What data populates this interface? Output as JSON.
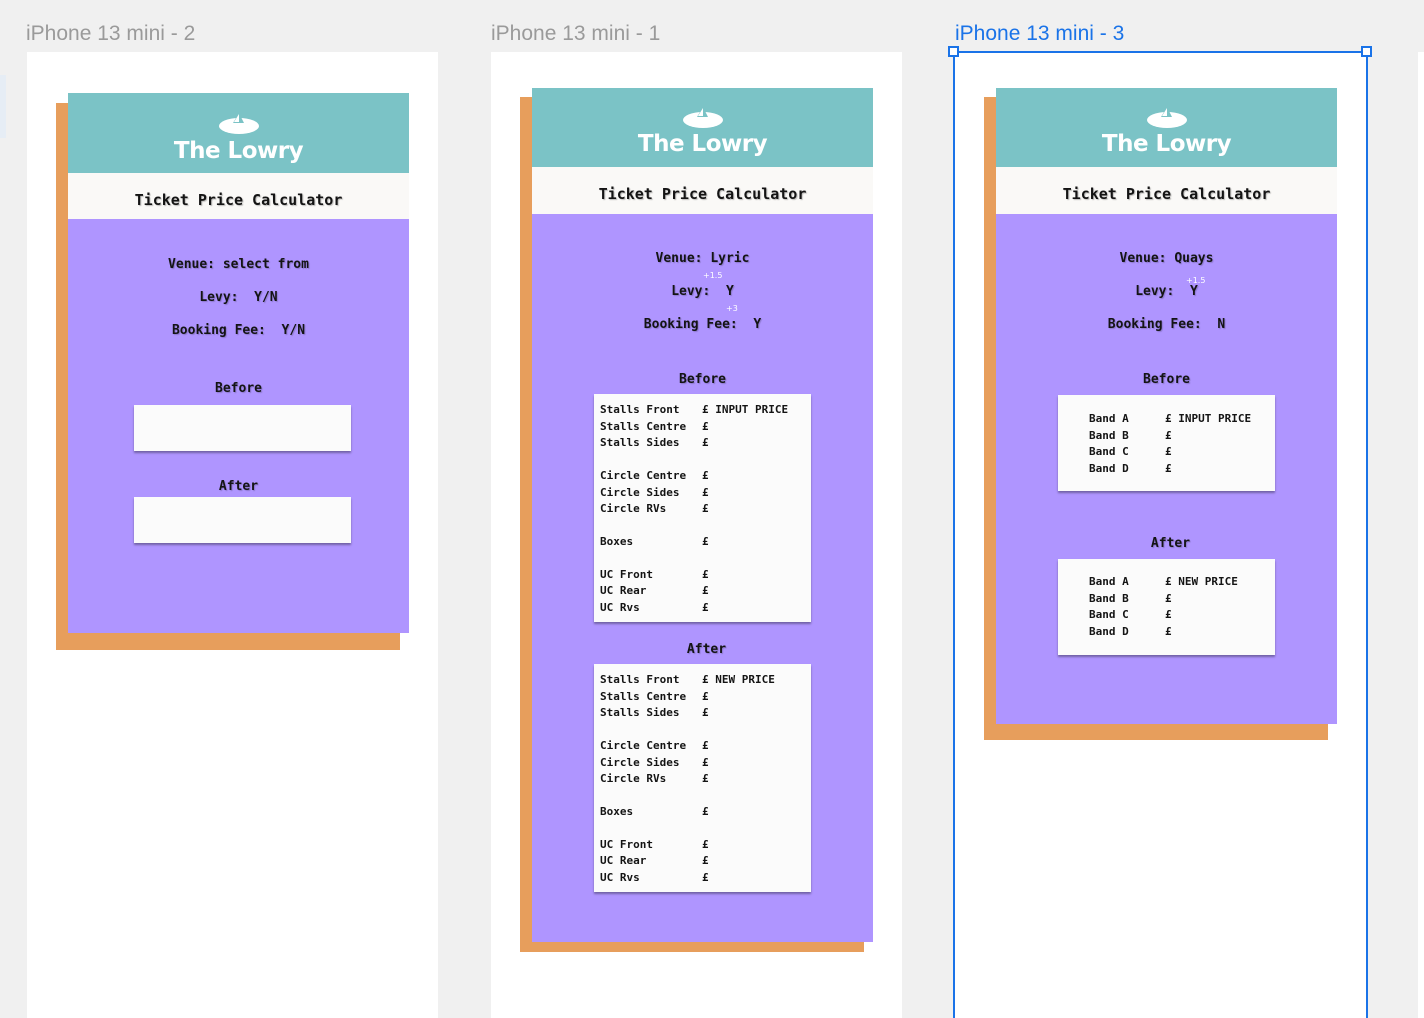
{
  "canvas": {
    "background": "#f0f0f0"
  },
  "colors": {
    "teal": "#7bc3c6",
    "purple": "#af95ff",
    "orange": "#e79e5c",
    "selection": "#1a73e8"
  },
  "frames": [
    {
      "label": "iPhone 13 mini - 2",
      "logo_text": "The Lowry",
      "title": "Ticket Price Calculator",
      "venue": "Venue: select from",
      "levy": "Levy:  Y/N",
      "booking_fee": "Booking Fee:  Y/N",
      "before_label": "Before",
      "after_label": "After"
    },
    {
      "label": "iPhone 13 mini - 1",
      "logo_text": "The Lowry",
      "title": "Ticket Price Calculator",
      "venue": "Venue: Lyric",
      "levy": "Levy:  Y",
      "levy_note": "+1.5",
      "booking_fee": "Booking Fee:  Y",
      "booking_note": "+3",
      "before_label": "Before",
      "after_label": "After",
      "before_rows": [
        [
          "Stalls Front",
          "£ INPUT PRICE"
        ],
        [
          "Stalls Centre",
          "£"
        ],
        [
          "Stalls Sides",
          "£"
        ],
        [
          "Circle Centre",
          "£"
        ],
        [
          "Circle Sides",
          "£"
        ],
        [
          "Circle RVs",
          "£"
        ],
        [
          "Boxes",
          "£"
        ],
        [
          "UC Front",
          "£"
        ],
        [
          "UC Rear",
          "£"
        ],
        [
          "UC Rvs",
          "£"
        ]
      ],
      "after_rows": [
        [
          "Stalls Front",
          "£ NEW PRICE"
        ],
        [
          "Stalls Centre",
          "£"
        ],
        [
          "Stalls Sides",
          "£"
        ],
        [
          "Circle Centre",
          "£"
        ],
        [
          "Circle Sides",
          "£"
        ],
        [
          "Circle RVs",
          "£"
        ],
        [
          "Boxes",
          "£"
        ],
        [
          "UC Front",
          "£"
        ],
        [
          "UC Rear",
          "£"
        ],
        [
          "UC Rvs",
          "£"
        ]
      ]
    },
    {
      "label": "iPhone 13 mini - 3",
      "logo_text": "The Lowry",
      "title": "Ticket Price Calculator",
      "venue": "Venue: Quays",
      "levy": "Levy:  Y",
      "levy_note": "+1.5",
      "booking_fee": "Booking Fee:  N",
      "before_label": "Before",
      "after_label": "After",
      "before_rows": [
        [
          "Band A",
          "£ INPUT PRICE"
        ],
        [
          "Band B",
          "£"
        ],
        [
          "Band C",
          "£"
        ],
        [
          "Band D",
          "£"
        ]
      ],
      "after_rows": [
        [
          "Band A",
          "£ NEW PRICE"
        ],
        [
          "Band B",
          "£"
        ],
        [
          "Band C",
          "£"
        ],
        [
          "Band D",
          "£"
        ]
      ]
    }
  ]
}
